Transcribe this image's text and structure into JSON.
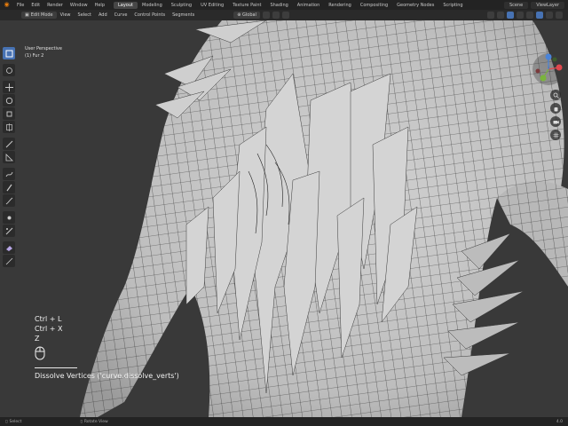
{
  "topbar": {
    "menus": [
      "File",
      "Edit",
      "Render",
      "Window",
      "Help"
    ],
    "workspace_tabs": [
      {
        "label": "Layout",
        "active": true
      },
      {
        "label": "Modeling",
        "active": false
      },
      {
        "label": "Sculpting",
        "active": false
      },
      {
        "label": "UV Editing",
        "active": false
      },
      {
        "label": "Texture Paint",
        "active": false
      },
      {
        "label": "Shading",
        "active": false
      },
      {
        "label": "Animation",
        "active": false
      },
      {
        "label": "Rendering",
        "active": false
      },
      {
        "label": "Compositing",
        "active": false
      },
      {
        "label": "Geometry Nodes",
        "active": false
      },
      {
        "label": "Scripting",
        "active": false
      }
    ],
    "scene_name": "Scene",
    "view_layer": "ViewLayer"
  },
  "viewport_header": {
    "mode": "Edit Mode",
    "menus": [
      "View",
      "Select",
      "Add",
      "Curve",
      "Control Points",
      "Segments"
    ],
    "transform_orientation": "Global"
  },
  "viewport_overlay": {
    "view_name": "User Perspective",
    "object_name": "(1) Fur 2"
  },
  "screencast": {
    "keys": [
      "Ctrl + L",
      "Ctrl + X",
      "Z"
    ],
    "operator": "Dissolve Vertices ('curve.dissolve_verts')"
  },
  "statusbar": {
    "left": "Select",
    "middle": "Rotate View",
    "right": "4.0"
  },
  "colors": {
    "accent": "#4772b3",
    "background": "#393939",
    "mesh": "#c4c4c4",
    "wire": "#2e2e2e"
  },
  "icons": {
    "blender_logo": "blender-logo-icon",
    "tools": [
      "select-box-icon",
      "cursor-icon",
      "move-icon",
      "rotate-icon",
      "scale-icon",
      "transform-icon",
      "annotate-icon",
      "measure-icon",
      "draw-icon",
      "pen-icon",
      "tilt-icon",
      "radius-icon",
      "randomize-icon",
      "extrude-icon",
      "shrink-fatten-icon"
    ],
    "nav": [
      "zoom-icon",
      "hand-icon",
      "camera-icon",
      "grid-icon"
    ]
  }
}
